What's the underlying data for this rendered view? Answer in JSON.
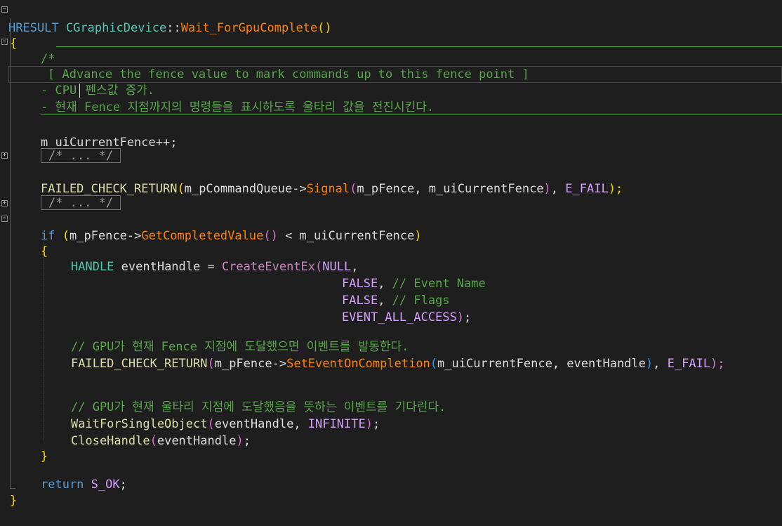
{
  "lines": {
    "l1": {
      "ret": "HRESULT",
      "cls": "CGraphicDevice",
      "sep": "::",
      "fn": "Wait_ForGpuComplete",
      "paren": "()"
    },
    "l2": "{",
    "l3": "/*",
    "l4": "[ Advance the fence value to mark commands up to this fence point ]",
    "l5a": "- CPU",
    "l5b": " 펜스값 증가.",
    "l6": "- 현재 Fence 지점까지의 명령들을 표시하도록 울타리 값을 전진시킨다.",
    "l8": "m_uiCurrentFence++;",
    "collapsed1": "/* ... */",
    "l10": {
      "macro": "FAILED_CHECK_RETURN",
      "p1": "(",
      "a1": "m_pCommandQueue",
      "arrow": "->",
      "fn": "Signal",
      "p2": "(",
      "a2": "m_pFence",
      "c1": ", ",
      "a3": "m_uiCurrentFence",
      "p3": ")",
      "c2": ", ",
      "efail": "E_FAIL",
      "end": ");"
    },
    "collapsed2": "/* ... */",
    "l13": {
      "kw": "if",
      "open": " (",
      "a1": "m_pFence",
      "arrow": "->",
      "fn": "GetCompletedValue",
      "pp": "()",
      "op": " < ",
      "a2": "m_uiCurrentFence",
      "close": ")"
    },
    "l14": "{",
    "l15": {
      "type": "HANDLE",
      "var": " eventHandle = ",
      "fn": "CreateEventEx",
      "p": "(",
      "arg": "NULL",
      "c": ","
    },
    "l16": {
      "arg": "FALSE",
      "c": ", ",
      "cm": "// Event Name"
    },
    "l17": {
      "arg": "FALSE",
      "c": ", ",
      "cm": "// Flags"
    },
    "l18": {
      "arg": "EVENT_ALL_ACCESS",
      "p": ")",
      "end": ";"
    },
    "l20": "// GPU가 현재 Fence 지점에 도달했으면 이벤트를 발동한다.",
    "l21": {
      "macro": "FAILED_CHECK_RETURN",
      "p1": "(",
      "a1": "m_pFence",
      "arrow": "->",
      "fn": "SetEventOnCompletion",
      "p2": "(",
      "a2": "m_uiCurrentFence",
      "c1": ", ",
      "a3": "eventHandle",
      "p3": ")",
      "c2": ", ",
      "efail": "E_FAIL",
      "end": ");"
    },
    "l23": "// GPU가 현재 울타리 지점에 도달했음을 뜻하는 이벤트를 기다린다.",
    "l24": {
      "fn": "WaitForSingleObject",
      "p": "(",
      "a1": "eventHandle",
      "c": ", ",
      "a2": "INFINITE",
      "pc": ")",
      "end": ";"
    },
    "l25": {
      "fn": "CloseHandle",
      "p": "(",
      "a1": "eventHandle",
      "pc": ")",
      "end": ";"
    },
    "l26": "}",
    "l28": {
      "kw": "return",
      "sp": " ",
      "val": "S_OK",
      "end": ";"
    },
    "l29": "}"
  },
  "colors": {
    "background": "#1e1e1e",
    "keyword": "#569cd6",
    "comment": "#57a64a",
    "function": "#ff8000",
    "macro": "#beb7ff"
  }
}
